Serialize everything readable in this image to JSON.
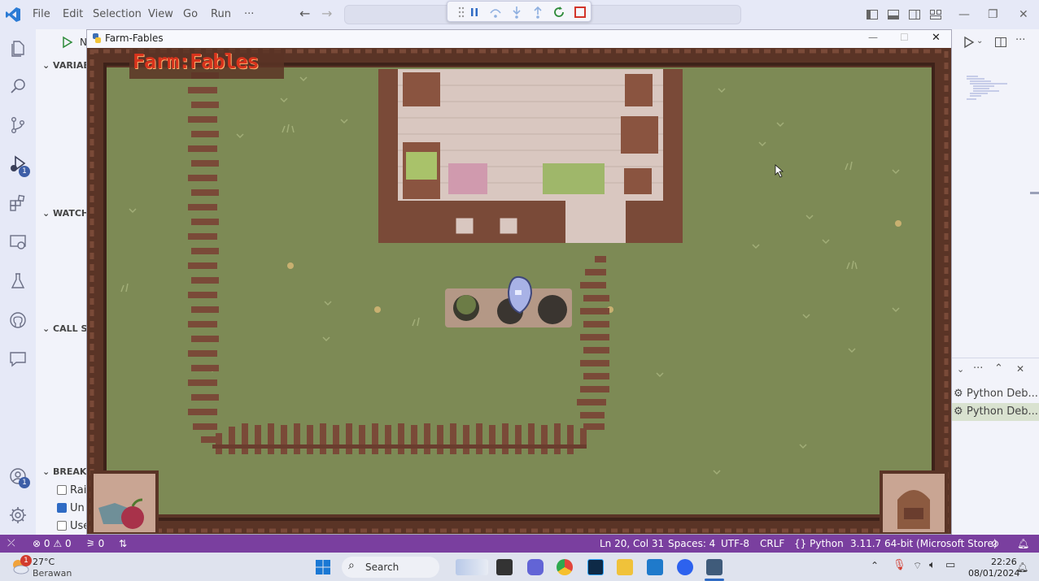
{
  "menu": [
    "File",
    "Edit",
    "Selection",
    "View",
    "Go",
    "Run",
    "···"
  ],
  "sidebar": {
    "run_label": "N",
    "sections": [
      "VARIAB",
      "WATCH",
      "CALL ST",
      "BREAKI"
    ],
    "breakpoints": [
      {
        "label": "Rai",
        "checked": false
      },
      {
        "label": "Un",
        "checked": true
      },
      {
        "label": "Use",
        "checked": false
      }
    ]
  },
  "activity_badges": {
    "run": "1",
    "account": "1"
  },
  "game": {
    "window_title": "Farm-Fables",
    "logo_text": "Farm:Fables"
  },
  "right_pane": {
    "items": [
      "Python Deb...",
      "Python Deb..."
    ]
  },
  "status": {
    "errors": "0",
    "warnings": "0",
    "ports": "0",
    "position": "Ln 20, Col 31",
    "spaces": "Spaces: 4",
    "encoding": "UTF-8",
    "eol": "CRLF",
    "language": "Python",
    "interpreter": "3.11.7 64-bit (Microsoft Store)"
  },
  "taskbar": {
    "weather_temp": "27°C",
    "weather_desc": "Berawan",
    "weather_badge": "1",
    "search_label": "Search",
    "time": "22:26",
    "date": "08/01/2024"
  },
  "colors": {
    "statusbar": "#7a3f9f",
    "grass": "#7d8a55",
    "fence": "#7a4a38",
    "frame": "#5a3426",
    "logo": "#d8331c"
  }
}
